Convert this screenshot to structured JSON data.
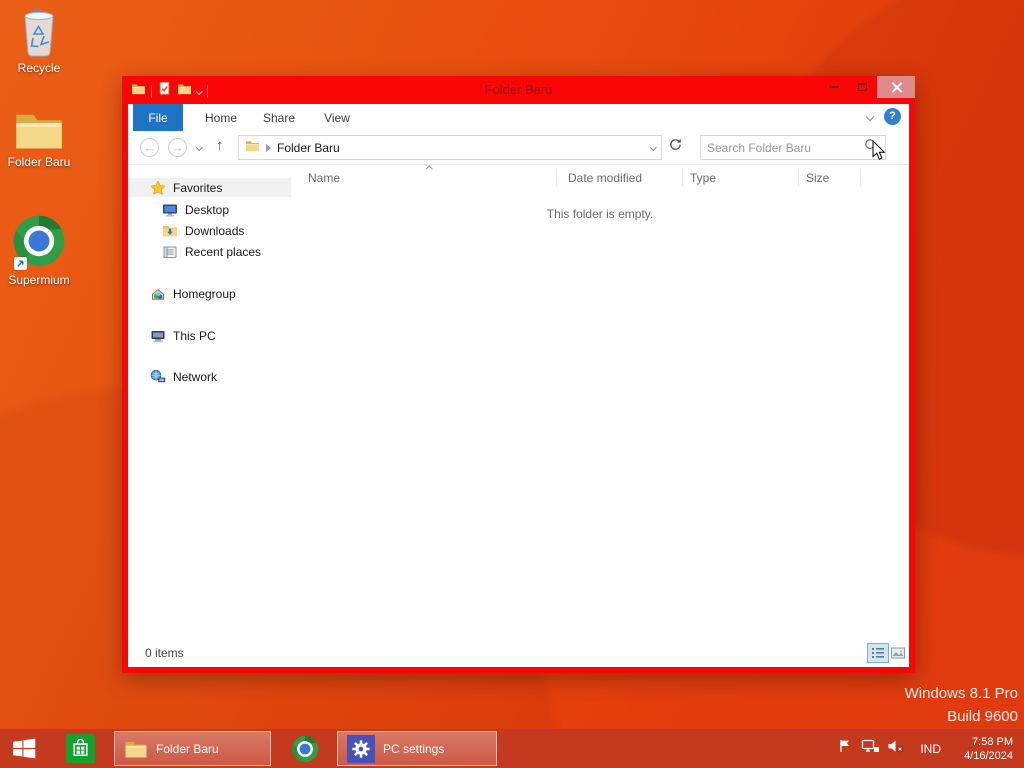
{
  "desktop": {
    "icons": [
      {
        "label": "Recycle"
      },
      {
        "label": "Folder Baru"
      },
      {
        "label": "Supermium"
      }
    ],
    "watermark": {
      "line1": "Windows 8.1 Pro",
      "line2": "Build 9600"
    }
  },
  "window": {
    "title": "Folder Baru",
    "ribbon": {
      "tabs": [
        {
          "label": "File"
        },
        {
          "label": "Home"
        },
        {
          "label": "Share"
        },
        {
          "label": "View"
        }
      ],
      "help_glyph": "?"
    },
    "nav": {
      "back_glyph": "←",
      "forward_glyph": "→",
      "up_glyph": "↑",
      "location": "Folder Baru",
      "search_placeholder": "Search Folder Baru"
    },
    "sidebar": {
      "items": [
        {
          "label": "Favorites"
        },
        {
          "label": "Desktop"
        },
        {
          "label": "Downloads"
        },
        {
          "label": "Recent places"
        },
        {
          "label": "Homegroup"
        },
        {
          "label": "This PC"
        },
        {
          "label": "Network"
        }
      ]
    },
    "list": {
      "columns": [
        {
          "label": "Name"
        },
        {
          "label": "Date modified"
        },
        {
          "label": "Type"
        },
        {
          "label": "Size"
        }
      ],
      "empty_message": "This folder is empty."
    },
    "status": {
      "item_count": "0 items"
    }
  },
  "taskbar": {
    "buttons": [
      {
        "label": "Folder Baru"
      },
      {
        "label": "PC settings"
      }
    ],
    "tray": {
      "language": "IND",
      "time": "7:58 PM",
      "date": "4/16/2024"
    }
  },
  "colors": {
    "window_chrome": "#fb0606",
    "desktop_orange": "#e8500f",
    "taskbar_red": "#c5391f",
    "file_tab_blue": "#1e73c4",
    "store_green": "#13a12f",
    "pc_settings_tile": "#4553b8",
    "title_text": "#8c1512"
  }
}
